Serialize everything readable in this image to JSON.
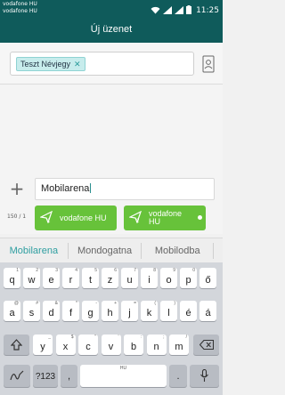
{
  "status_bar": {
    "carrier_1": "vodafone HU",
    "carrier_2": "vodafone HU",
    "time": "11:25"
  },
  "header": {
    "title": "Új üzenet"
  },
  "recipient": {
    "chip_label": "Teszt Névjegy"
  },
  "compose": {
    "text": "Mobilarena",
    "counter": "150 / 1",
    "send_1_sim": "1",
    "send_1_label": "vodafone HU",
    "send_2_sim": "2",
    "send_2_label_line1": "vodafone",
    "send_2_label_line2": "HU"
  },
  "suggestions": [
    "Mobilarena",
    "Mondogatna",
    "Mobilodba"
  ],
  "keyboard": {
    "row1": [
      {
        "k": "q",
        "a": "1"
      },
      {
        "k": "w",
        "a": "2"
      },
      {
        "k": "e",
        "a": "3"
      },
      {
        "k": "r",
        "a": "4"
      },
      {
        "k": "t",
        "a": "5"
      },
      {
        "k": "z",
        "a": "6"
      },
      {
        "k": "u",
        "a": "7"
      },
      {
        "k": "i",
        "a": "8"
      },
      {
        "k": "o",
        "a": "9"
      },
      {
        "k": "p",
        "a": "0"
      },
      {
        "k": "ő",
        "a": ""
      }
    ],
    "row2": [
      {
        "k": "a",
        "a": "@"
      },
      {
        "k": "s",
        "a": "#"
      },
      {
        "k": "d",
        "a": "&"
      },
      {
        "k": "f",
        "a": "*"
      },
      {
        "k": "g",
        "a": "-"
      },
      {
        "k": "h",
        "a": "+"
      },
      {
        "k": "j",
        "a": "="
      },
      {
        "k": "k",
        "a": "("
      },
      {
        "k": "l",
        "a": ")"
      },
      {
        "k": "é",
        "a": ""
      },
      {
        "k": "á",
        "a": ""
      }
    ],
    "row3": [
      {
        "k": "y",
        "a": "_"
      },
      {
        "k": "x",
        "a": "$"
      },
      {
        "k": "c",
        "a": "\""
      },
      {
        "k": "v",
        "a": "'"
      },
      {
        "k": "b",
        "a": ":"
      },
      {
        "k": "n",
        "a": ";"
      },
      {
        "k": "m",
        "a": "/"
      }
    ],
    "symbols_label": "?123",
    "comma": ",",
    "space_label": "HU",
    "period": "."
  }
}
